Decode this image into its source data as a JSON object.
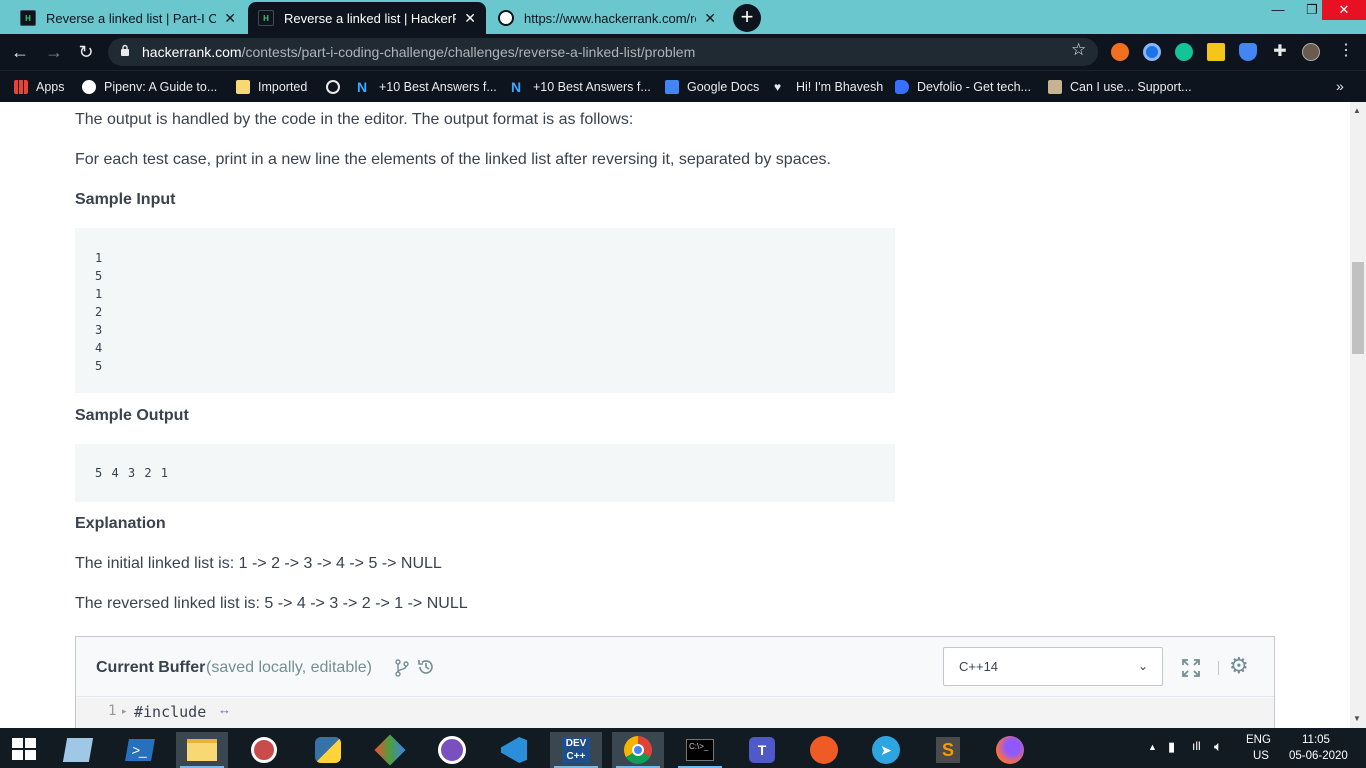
{
  "browser": {
    "tabs": [
      {
        "title": "Reverse a linked list | Part-I Codin",
        "active": false
      },
      {
        "title": "Reverse a linked list | HackerRank",
        "active": true
      },
      {
        "title": "https://www.hackerrank.com/rest",
        "active": false
      }
    ],
    "url_host": "hackerrank.com",
    "url_path": "/contests/part-i-coding-challenge/challenges/reverse-a-linked-list/problem",
    "bookmarks": [
      {
        "label": "Apps",
        "icon": "apps-grid-icon"
      },
      {
        "label": "Pipenv: A Guide to...",
        "icon": "pipenv-icon"
      },
      {
        "label": "Imported",
        "icon": "folder-icon"
      },
      {
        "label": "",
        "icon": "globe-icon"
      },
      {
        "label": "+10 Best Answers f...",
        "icon": "n-logo-icon"
      },
      {
        "label": "+10 Best Answers f...",
        "icon": "n-logo-icon"
      },
      {
        "label": "Google Docs",
        "icon": "google-docs-icon"
      },
      {
        "label": "Hi! I'm Bhavesh",
        "icon": "heart-icon"
      },
      {
        "label": "Devfolio - Get tech...",
        "icon": "devfolio-icon"
      },
      {
        "label": "Can I use... Support...",
        "icon": "caniuse-icon"
      }
    ],
    "more_bookmarks": "»"
  },
  "problem": {
    "output_text": "The output is handled by the code in the editor. The output format is as follows:",
    "output_format": "For each test case, print in a new line the elements of the linked list after reversing it, separated by spaces.",
    "sample_input_heading": "Sample Input",
    "sample_input_lines": [
      "1",
      "5",
      "1",
      "2",
      "3",
      "4",
      "5"
    ],
    "sample_output_heading": "Sample Output",
    "sample_output": "5 4 3 2 1",
    "explanation_heading": "Explanation",
    "explanation_1": "The initial linked list is: 1 -> 2 -> 3 -> 4 -> 5 -> NULL",
    "explanation_2": "The reversed linked list is: 5 -> 4 -> 3 -> 2 -> 1 -> NULL"
  },
  "editor": {
    "buffer_title": "Current Buffer",
    "buffer_subtitle": "(saved locally, editable)",
    "language": "C++14",
    "line_number": "1",
    "code_line": "#include"
  },
  "taskbar": {
    "lang": "ENG",
    "region": "US",
    "time": "11:05",
    "date": "05-06-2020"
  },
  "colors": {
    "tab_bar": "#69c7cd",
    "chrome_dark": "#0e141e",
    "hr_green": "#39c76f",
    "code_bg": "#f3f7f7"
  }
}
